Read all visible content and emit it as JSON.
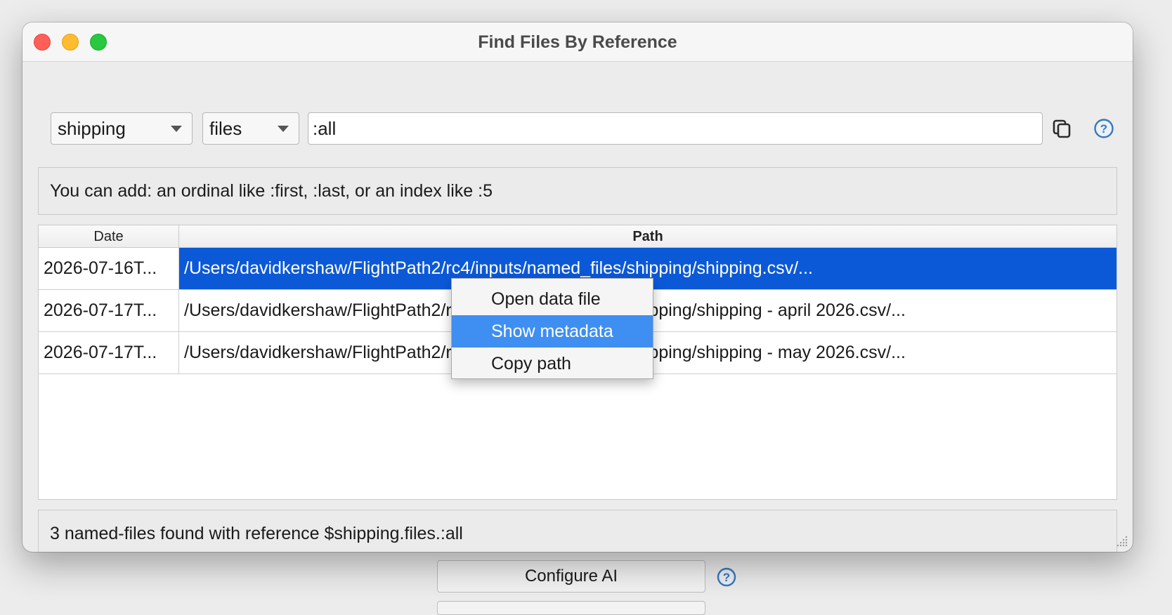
{
  "window": {
    "title": "Find Files By Reference"
  },
  "toolbar": {
    "owner_value": "shipping",
    "type_value": "files",
    "reference_value": ":all"
  },
  "hint": "You can add: an ordinal like :first, :last, or an index like :5",
  "table": {
    "columns": [
      "Date",
      "Path"
    ],
    "rows": [
      {
        "date": "2026-07-16T...",
        "path": "/Users/davidkershaw/FlightPath2/rc4/inputs/named_files/shipping/shipping.csv/..."
      },
      {
        "date": "2026-07-17T...",
        "path": "/Users/davidkershaw/FlightPath2/rc4/inputs/named_files/shipping/shipping - april 2026.csv/..."
      },
      {
        "date": "2026-07-17T...",
        "path": "/Users/davidkershaw/FlightPath2/rc4/inputs/named_files/shipping/shipping - may 2026.csv/..."
      }
    ],
    "selected_row": 0
  },
  "context_menu": {
    "items": [
      "Open data file",
      "Show metadata",
      "Copy path"
    ],
    "highlighted": 1
  },
  "status": "3 named-files found with reference $shipping.files.:all",
  "background": {
    "configure_ai_label": "Configure AI"
  },
  "colors": {
    "selection": "#0c59d8",
    "menu_highlight": "#3f8ef2",
    "help_icon": "#3a77b7"
  }
}
